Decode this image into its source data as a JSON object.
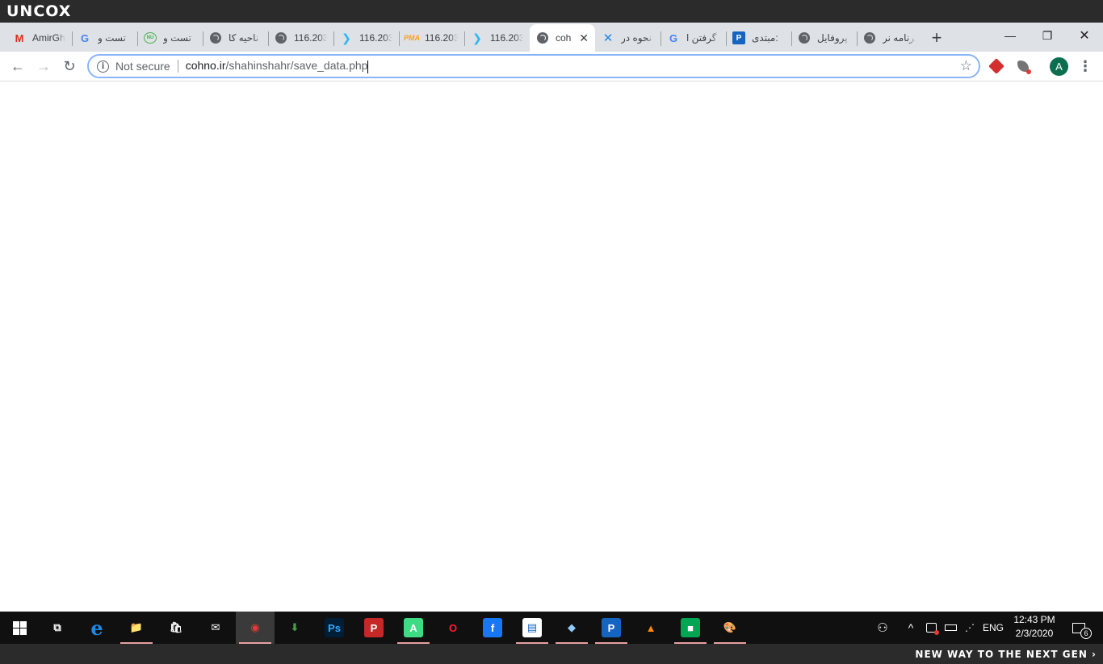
{
  "brand": {
    "logo": "UNCOX",
    "slogan": "NEW WAY TO THE NEXT GEN ›"
  },
  "tabs": [
    {
      "title": "AmirGh",
      "icon": "gmail-icon",
      "glyph": "M"
    },
    {
      "title": "تست و",
      "icon": "google-icon",
      "glyph": "G"
    },
    {
      "title": "تست و",
      "icon": "green-circle-icon",
      "glyph": "NU"
    },
    {
      "title": "ناحیه کا",
      "icon": "globe-icon",
      "glyph": ""
    },
    {
      "title": "116.203",
      "icon": "globe-icon",
      "glyph": ""
    },
    {
      "title": "116.203",
      "icon": "arrow-icon",
      "glyph": "❯"
    },
    {
      "title": "116.203",
      "icon": "phpmyadmin-icon",
      "glyph": "PMA"
    },
    {
      "title": "116.203",
      "icon": "arrow-icon",
      "glyph": "❯"
    },
    {
      "title": "coh",
      "icon": "globe-icon",
      "glyph": "",
      "active": true,
      "close": "✕"
    },
    {
      "title": "نحوه در",
      "icon": "x-logo-icon",
      "glyph": "✕"
    },
    {
      "title": "گرفتن ا",
      "icon": "google-icon",
      "glyph": "G"
    },
    {
      "title": "مبتدی: ",
      "icon": "blue-square-icon",
      "glyph": "P"
    },
    {
      "title": "پروفایل",
      "icon": "globe-icon",
      "glyph": ""
    },
    {
      "title": "برنامه نر",
      "icon": "globe-icon",
      "glyph": ""
    }
  ],
  "new_tab": "+",
  "window_controls": {
    "minimize": "—",
    "restore": "❐",
    "close": "✕"
  },
  "toolbar": {
    "back": "←",
    "forward": "→",
    "reload": "↻",
    "star": "☆",
    "menu": "⋮"
  },
  "omnibox": {
    "security_icon": "i",
    "security_label": "Not secure",
    "url_host": "cohno.ir",
    "url_path": "/shahinshahr/save_data.php"
  },
  "profile": {
    "initial": "A"
  },
  "taskbar": {
    "apps": [
      {
        "name": "task-view-icon",
        "glyph": "⧉"
      },
      {
        "name": "edge-icon",
        "glyph": "e",
        "color": "#1e88e5"
      },
      {
        "name": "file-explorer-icon",
        "glyph": "📁",
        "color": "#f2c744",
        "running": true
      },
      {
        "name": "store-icon",
        "glyph": "🛍",
        "color": "#ffffff"
      },
      {
        "name": "mail-icon",
        "glyph": "✉",
        "color": "#ffffff"
      },
      {
        "name": "chrome-icon",
        "glyph": "◉",
        "color": "#e53935",
        "active": true,
        "running": true
      },
      {
        "name": "download-manager-icon",
        "glyph": "⬇",
        "color": "#43a047"
      },
      {
        "name": "photoshop-icon",
        "glyph": "Ps",
        "color": "#31a8ff",
        "bg": "#001e36"
      },
      {
        "name": "p-app-icon",
        "glyph": "P",
        "color": "#ffffff",
        "bg": "#c62828"
      },
      {
        "name": "android-studio-icon",
        "glyph": "A",
        "color": "#ffffff",
        "bg": "#3ddc84",
        "running": true
      },
      {
        "name": "opera-icon",
        "glyph": "O",
        "color": "#ff1b2d"
      },
      {
        "name": "facebook-icon",
        "glyph": "f",
        "color": "#ffffff",
        "bg": "#1877f2"
      },
      {
        "name": "document-icon",
        "glyph": "▤",
        "color": "#1565c0",
        "bg": "#ffffff",
        "running": true
      },
      {
        "name": "blue-notebook-icon",
        "glyph": "◆",
        "color": "#90caf9",
        "running": true
      },
      {
        "name": "p-blue-app-icon",
        "glyph": "P",
        "color": "#ffffff",
        "bg": "#1565c0",
        "running": true
      },
      {
        "name": "vlc-icon",
        "glyph": "▲",
        "color": "#ff8800"
      },
      {
        "name": "green-app-icon",
        "glyph": "■",
        "color": "#ffffff",
        "bg": "#00a651",
        "running": true
      },
      {
        "name": "paint-icon",
        "glyph": "🎨",
        "color": "#ffffff",
        "running": true
      }
    ],
    "tray": {
      "people": "⚇",
      "chevron": "^",
      "lang": "ENG",
      "time": "12:43 PM",
      "date": "2/3/2020",
      "notifications": "6"
    }
  }
}
